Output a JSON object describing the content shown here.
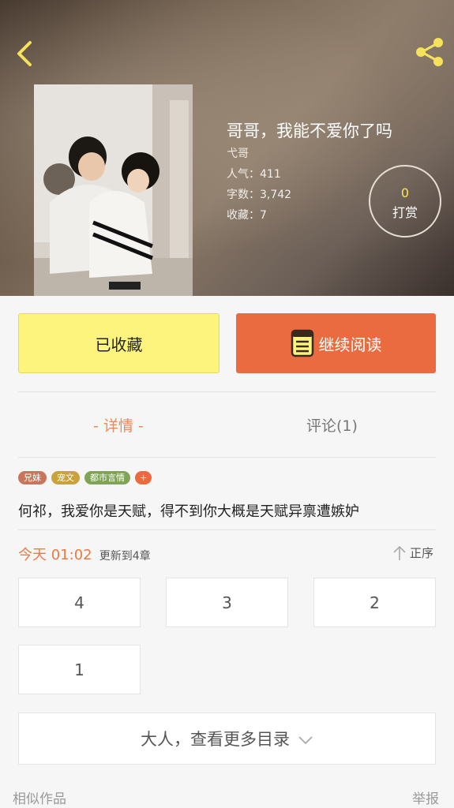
{
  "book": {
    "title": "哥哥，我能不爱你了吗",
    "author": "弋哥",
    "popularity": "人气：411",
    "word_count": "字数：3,742",
    "favorites": "收藏：7"
  },
  "tip": {
    "count": "0",
    "label": "打赏"
  },
  "actions": {
    "favorited_label": "已收藏",
    "continue_label": "继续阅读"
  },
  "tabs": [
    {
      "label": "- 详情 -",
      "active": true
    },
    {
      "label": "评论(1)",
      "active": false
    }
  ],
  "tags": [
    {
      "label": "兄妹",
      "color": "#c9755c"
    },
    {
      "label": "宠文",
      "color": "#c9a23c"
    },
    {
      "label": "都市言情",
      "color": "#7fa456"
    },
    {
      "label": "+",
      "color": "#ea6b3f"
    }
  ],
  "description": "何祁，我爱你是天赋，得不到你大概是天赋异禀遭嫉妒",
  "update": {
    "time": "今天 01:02",
    "text": "更新到4章"
  },
  "order_label": "正序",
  "chapters": [
    "4",
    "3",
    "2",
    "1"
  ],
  "more_catalog_label": "大人，查看更多目录",
  "footer": {
    "similar": "相似作品",
    "report": "举报"
  },
  "colors": {
    "accent": "#ea6b3f",
    "favorite_bg": "#fdf47d",
    "tab_active": "#ea8a55"
  }
}
